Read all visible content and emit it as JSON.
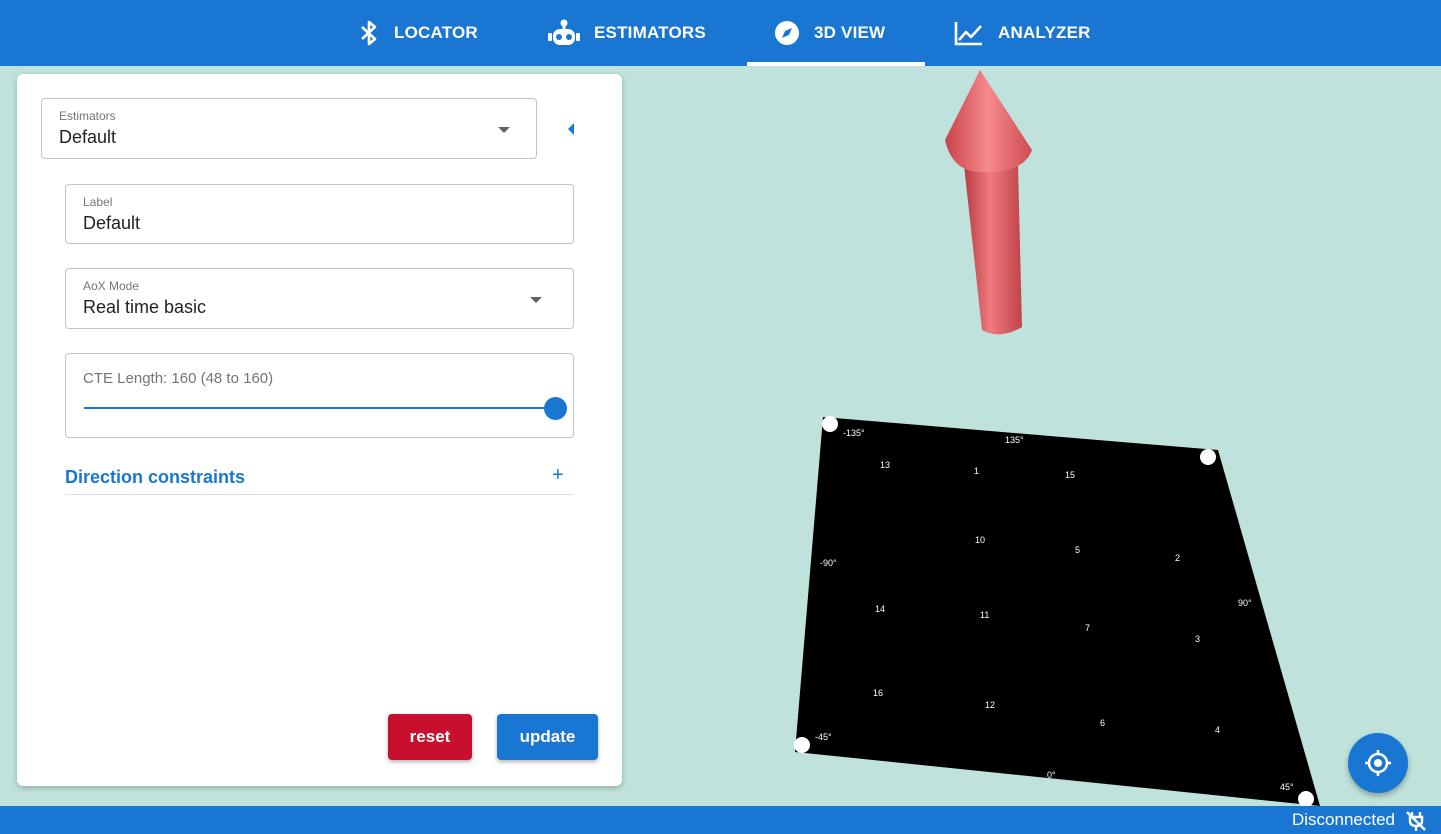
{
  "nav": {
    "tabs": [
      {
        "label": "LOCATOR",
        "icon": "bluetooth-icon"
      },
      {
        "label": "ESTIMATORS",
        "icon": "robot-icon"
      },
      {
        "label": "3D VIEW",
        "icon": "compass-icon",
        "active": true
      },
      {
        "label": "ANALYZER",
        "icon": "chart-line-icon"
      }
    ]
  },
  "panel": {
    "estimators": {
      "label": "Estimators",
      "value": "Default"
    },
    "label_field": {
      "label": "Label",
      "value": "Default"
    },
    "aox_mode": {
      "label": "AoX Mode",
      "value": "Real time basic"
    },
    "cte": {
      "text": "CTE Length: 160 (48 to 160)",
      "value": 160,
      "min": 48,
      "max": 160
    },
    "direction": {
      "label": "Direction constraints",
      "toggle": "+"
    },
    "buttons": {
      "reset": "reset",
      "update": "update"
    }
  },
  "status": {
    "text": "Disconnected",
    "icon": "plug-off-icon"
  },
  "colors": {
    "primary": "#1976d2",
    "reset": "#c8102e",
    "arrow": "#e05a5f",
    "background": "#bfe3dc"
  },
  "board": {
    "labels": [
      "135°",
      "-135°",
      "-90°",
      "90°",
      "-45°",
      "45°",
      "0°",
      "1",
      "2",
      "3",
      "4",
      "5",
      "6",
      "7",
      "10",
      "11",
      "12",
      "13",
      "14",
      "15",
      "16"
    ]
  }
}
